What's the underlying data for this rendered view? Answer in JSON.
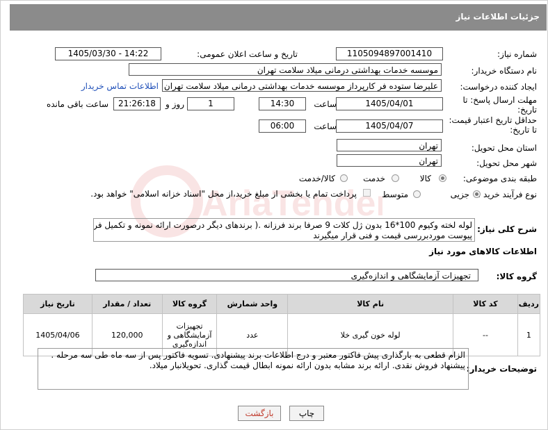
{
  "header": {
    "title": "جزئیات اطلاعات نیاز"
  },
  "fields": {
    "need_number_label": "شماره نیاز:",
    "need_number": "1105094897001410",
    "announce_label": "تاریخ و ساعت اعلان عمومی:",
    "announce_value": "1405/03/30 - 14:22",
    "buyer_org_label": "نام دستگاه خریدار:",
    "buyer_org": "موسسه خدمات بهداشتی درمانی میلاد سلامت تهران",
    "creator_label": "ایجاد کننده درخواست:",
    "creator": "علیرضا ستوده فر کارپرداز موسسه خدمات بهداشتی درمانی میلاد سلامت تهران",
    "contact_link": "اطلاعات تماس خریدار",
    "deadline_label": "مهلت ارسال پاسخ: تا تاریخ:",
    "deadline_date": "1405/04/01",
    "time_label": "ساعت",
    "deadline_time": "14:30",
    "days_value": "1",
    "days_label": "روز و",
    "remaining_time": "21:26:18",
    "remaining_label": "ساعت باقی مانده",
    "validity_label": "حداقل تاریخ اعتبار قیمت: تا تاریخ:",
    "validity_date": "1405/04/07",
    "validity_time": "06:00",
    "province_label": "استان محل تحویل:",
    "province": "تهران",
    "city_label": "شهر محل تحویل:",
    "city": "تهران",
    "category_label": "طبقه بندی موضوعی:",
    "category_options": [
      "کالا",
      "خدمت",
      "کالا/خدمت"
    ],
    "process_label": "نوع فرآیند خرید :",
    "process_options": [
      "جزیی",
      "متوسط"
    ],
    "payment_note": "پرداخت تمام یا بخشی از مبلغ خرید،از محل \"اسناد خزانه اسلامی\" خواهد بود."
  },
  "description": {
    "label": "شرح کلی نیاز:",
    "line1": "لوله لخته وکیوم 100*16 بدون ژل کلات 9 صرفا برند فرزانه .( برندهای دیگر درصورت ارائه نمونه و تکمیل فرم",
    "line2": "پیوست موردبررسی قیمت و فنی قرار میگیرند"
  },
  "goods_info_title": "اطلاعات کالاهای مورد نیاز",
  "goods_group": {
    "label": "گروه کالا:",
    "value": "تجهیزات آزمایشگاهی و اندازه‌گیری"
  },
  "table": {
    "headers": [
      "ردیف",
      "کد کالا",
      "نام کالا",
      "واحد شمارش",
      "گروه کالا",
      "تعداد / مقدار",
      "تاریخ نیاز"
    ],
    "rows": [
      {
        "row": "1",
        "code": "--",
        "name": "لوله خون گیری خلا",
        "unit": "عدد",
        "group_l1": "تجهیزات",
        "group_l2": "آزمایشگاهی و",
        "group_l3": "اندازه‌گیری",
        "qty": "120,000",
        "date": "1405/04/06"
      }
    ]
  },
  "buyer_notes": {
    "label": "توضیحات خریدار:",
    "line1": "الزام قطعی به بارگذاری پیش فاکتور معتبر و درج اطلاعات برند پیشنهادی. تسویه فاکتور پس از سه ماه طی سه مرحله .",
    "line2": "پیشنهاد فروش نقدی. ارائه برند مشابه بدون ارائه نمونه ابطال قیمت گذاری. تحویلانبار میلاد."
  },
  "buttons": {
    "print": "چاپ",
    "back": "بازگشت"
  },
  "watermark": {
    "text": "AriaTender.net"
  }
}
